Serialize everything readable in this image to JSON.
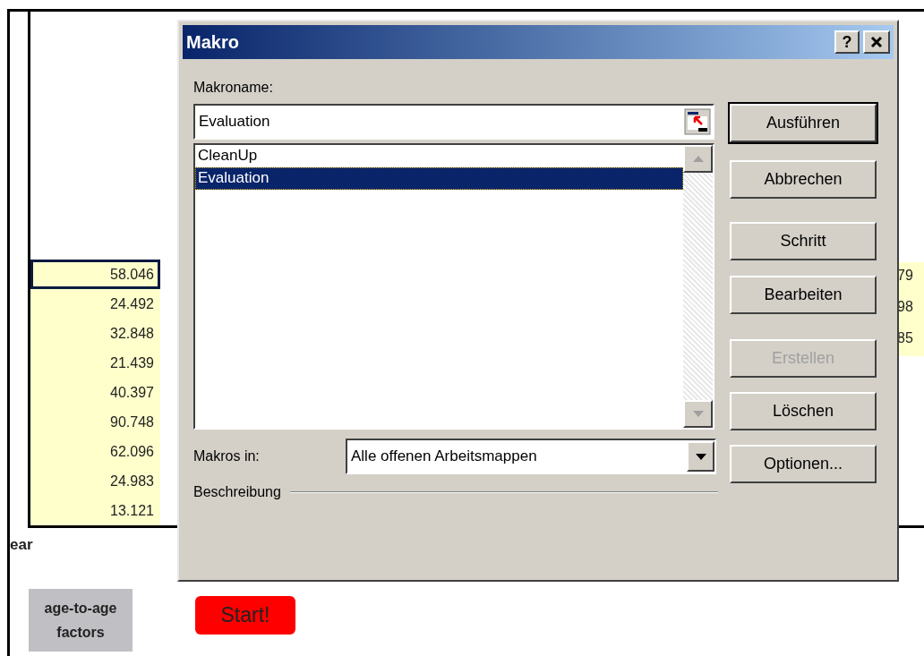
{
  "sheet": {
    "column_1": [
      {
        "value": "58.046",
        "selected": true
      },
      {
        "value": "24.492",
        "selected": false
      },
      {
        "value": "32.848",
        "selected": false
      },
      {
        "value": "21.439",
        "selected": false
      },
      {
        "value": "40.397",
        "selected": false
      },
      {
        "value": "90.748",
        "selected": false
      },
      {
        "value": "62.096",
        "selected": false
      },
      {
        "value": "24.983",
        "selected": false
      },
      {
        "value": "13.121",
        "selected": false
      }
    ],
    "column_2": [
      "79",
      "98",
      "85"
    ],
    "row_label": "ear",
    "factors_label": "age-to-age factors",
    "start_button": "Start!"
  },
  "dialog": {
    "title": "Makro",
    "help_button": "?",
    "name_label": "Makroname:",
    "name_value": "Evaluation",
    "macros": [
      {
        "name": "CleanUp",
        "selected": false
      },
      {
        "name": "Evaluation",
        "selected": true
      }
    ],
    "location_label": "Makros in:",
    "location_value": "Alle offenen Arbeitsmappen",
    "description_label": "Beschreibung",
    "buttons": [
      {
        "label": "Ausführen",
        "default": true,
        "disabled": false
      },
      {
        "label": "Abbrechen",
        "default": false,
        "disabled": false
      },
      {
        "label": "Schritt",
        "default": false,
        "disabled": false
      },
      {
        "label": "Bearbeiten",
        "default": false,
        "disabled": false
      },
      {
        "label": "Erstellen",
        "default": false,
        "disabled": true
      },
      {
        "label": "Löschen",
        "default": false,
        "disabled": false
      },
      {
        "label": "Optionen...",
        "default": false,
        "disabled": false
      }
    ]
  }
}
